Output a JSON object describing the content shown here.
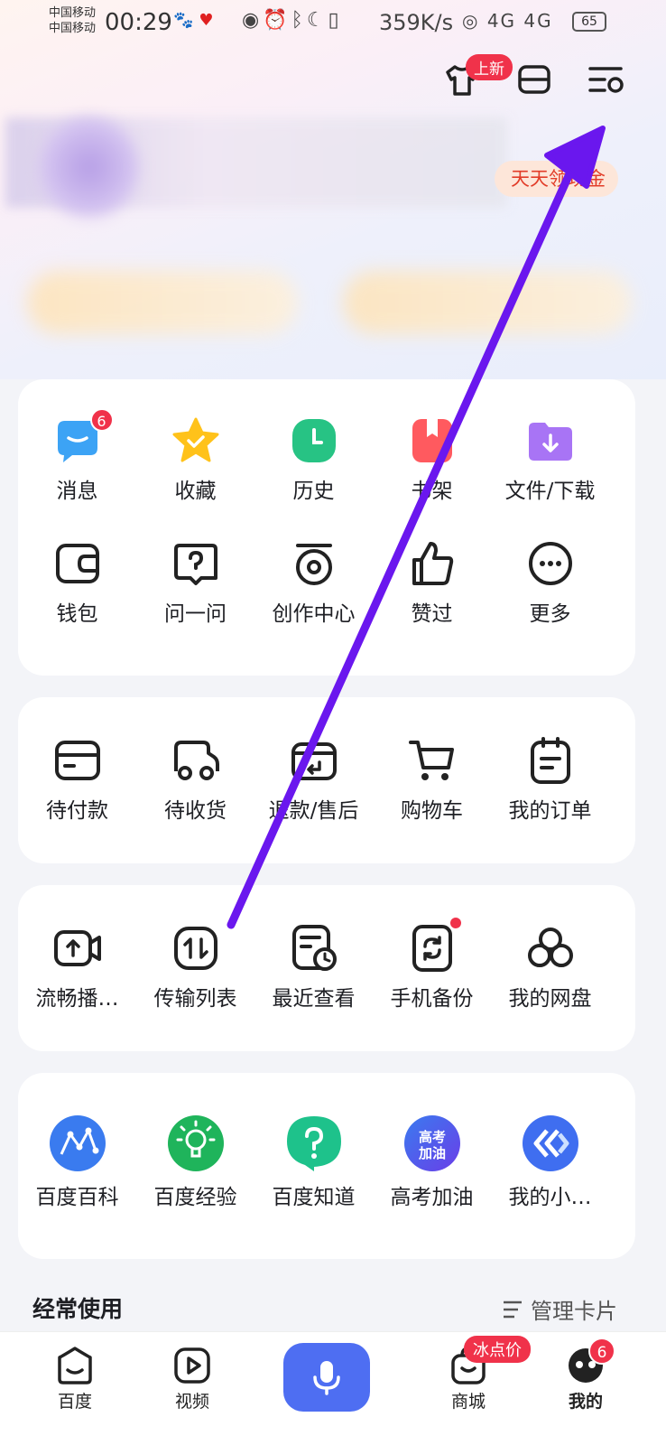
{
  "status_bar": {
    "carrier1": "中国移动",
    "carrier2": "中国移动",
    "time": "00:29",
    "speed": "359K/s",
    "network": "4G 4G",
    "battery": "65"
  },
  "header": {
    "new_badge": "上新",
    "cash_pill": "天天领现金"
  },
  "grid1": [
    {
      "label": "消息",
      "icon": "message-icon",
      "badge": "6"
    },
    {
      "label": "收藏",
      "icon": "star-icon"
    },
    {
      "label": "历史",
      "icon": "clock-icon"
    },
    {
      "label": "书架",
      "icon": "bookshelf-icon"
    },
    {
      "label": "文件/下载",
      "icon": "folder-download-icon"
    },
    {
      "label": "钱包",
      "icon": "wallet-icon"
    },
    {
      "label": "问一问",
      "icon": "question-icon"
    },
    {
      "label": "创作中心",
      "icon": "create-icon"
    },
    {
      "label": "赞过",
      "icon": "thumbs-up-icon"
    },
    {
      "label": "更多",
      "icon": "more-icon"
    }
  ],
  "grid2": [
    {
      "label": "待付款",
      "icon": "card-icon"
    },
    {
      "label": "待收货",
      "icon": "truck-icon"
    },
    {
      "label": "退款/售后",
      "icon": "refund-icon"
    },
    {
      "label": "购物车",
      "icon": "cart-icon"
    },
    {
      "label": "我的订单",
      "icon": "order-icon"
    }
  ],
  "grid3": [
    {
      "label": "流畅播…",
      "icon": "video-upload-icon"
    },
    {
      "label": "传输列表",
      "icon": "transfer-icon"
    },
    {
      "label": "最近查看",
      "icon": "recent-icon"
    },
    {
      "label": "手机备份",
      "icon": "backup-icon"
    },
    {
      "label": "我的网盘",
      "icon": "cloud-icon"
    }
  ],
  "grid4": [
    {
      "label": "百度百科",
      "icon": "baike-icon"
    },
    {
      "label": "百度经验",
      "icon": "jingyan-icon"
    },
    {
      "label": "百度知道",
      "icon": "zhidao-icon"
    },
    {
      "label": "高考加油",
      "icon": "gaokao-icon",
      "logo_text": "高考加油"
    },
    {
      "label": "我的小…",
      "icon": "mini-app-icon"
    }
  ],
  "frequent": {
    "title": "经常使用",
    "manage": "管理卡片"
  },
  "bottom_nav": {
    "home": "百度",
    "video": "视频",
    "mall": "商城",
    "mall_badge": "冰点价",
    "me": "我的",
    "me_badge": "6"
  },
  "colors": {
    "accent": "#4e6ef2",
    "badge": "#f0324a",
    "arrow": "#6a17ee"
  }
}
